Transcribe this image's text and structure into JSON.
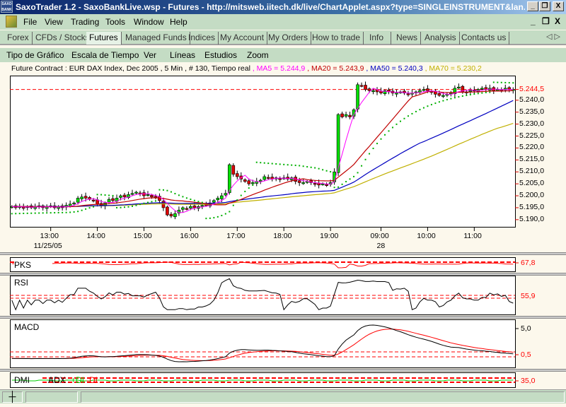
{
  "window": {
    "title": "SaxoTrader 1.2 - SaxoBankLive.wsp - Futures - http://mitsweb.iitech.dk/live/ChartApplet.aspx?type=SINGLEINSTRUMENT&lan...",
    "logo_text": "SAXO BANK",
    "minimize": "_",
    "restore": "❐",
    "close": "X"
  },
  "menu": {
    "items": [
      "File",
      "View",
      "Trading",
      "Tools",
      "Window",
      "Help"
    ],
    "doc_minimize": "_",
    "doc_restore": "❐",
    "doc_close": "X"
  },
  "tabs": {
    "items": [
      "Forex",
      "CFDs / Stocks",
      "Futures",
      "Managed Funds",
      "Indices",
      "My Account",
      "My Orders",
      "How to trade",
      "Info",
      "News",
      "Analysis",
      "Contacts us"
    ],
    "selected": "Futures",
    "prev": "◁",
    "next": "▷"
  },
  "chart_menu": {
    "items": [
      "Tipo de Gráfico",
      "Escala de Tiempo",
      "Ver",
      "Líneas",
      "Estudios",
      "Zoom"
    ]
  },
  "legend": {
    "contract": "Future Contract : EUR DAX Index, Dec 2005 , 5 Min , # 130, Tiempo real",
    "ma5": ", MA5 = 5.244,9",
    "ma20": ", MA20 = 5.243,9",
    "ma50": ", MA50 = 5.240,3",
    "ma70": ", MA70 = 5.230,2"
  },
  "colors": {
    "ma5": "#ff00ff",
    "ma20": "#c00000",
    "ma50": "#0000c0",
    "ma70": "#c0b000",
    "sar": "#00b000",
    "up": "#00e000",
    "down": "#e00000",
    "last": "#ff0000"
  },
  "chart_data": {
    "type": "candlestick",
    "title": "EUR DAX Index, Dec 2005, 5 Min",
    "ylim": [
      5187,
      5250
    ],
    "yticks": [
      "5.240,0",
      "5.235,0",
      "5.230,0",
      "5.225,0",
      "5.220,0",
      "5.215,0",
      "5.210,0",
      "5.205,0",
      "5.200,0",
      "5.195,0",
      "5.190,0"
    ],
    "ytick_values": [
      5240,
      5235,
      5230,
      5225,
      5220,
      5215,
      5210,
      5205,
      5200,
      5195,
      5190
    ],
    "last_price_label": "5.244,5",
    "last_price": 5244.5,
    "xticks": [
      "13:00",
      "14:00",
      "15:00",
      "16:00",
      "17:00",
      "18:00",
      "19:00",
      "09:00",
      "10:00",
      "11:00"
    ],
    "xtick_bars": [
      10.5,
      22.5,
      34.5,
      46.5,
      58.5,
      70.5,
      82.5,
      95.5,
      107.5,
      119.5
    ],
    "date_labels": [
      {
        "text": "11/25/05",
        "bar": 10.5
      },
      {
        "text": "28",
        "bar": 95.5
      }
    ],
    "close": [
      5195.5,
      5195,
      5195.5,
      5195,
      5195.5,
      5195,
      5195.5,
      5195.5,
      5195,
      5195.5,
      5195.5,
      5195,
      5195.5,
      5195,
      5196,
      5196.5,
      5197,
      5199,
      5199.5,
      5199,
      5198.5,
      5198,
      5196.5,
      5196,
      5197,
      5198.5,
      5198,
      5199,
      5200,
      5199.5,
      5200.5,
      5201,
      5201.5,
      5201,
      5200,
      5200.5,
      5199.5,
      5199.5,
      5198,
      5195,
      5192,
      5191.5,
      5192.5,
      5194,
      5195,
      5194.5,
      5195.5,
      5195,
      5195.5,
      5196,
      5196,
      5197,
      5198,
      5199,
      5200,
      5201,
      5213,
      5209,
      5208,
      5207,
      5206,
      5205,
      5205.5,
      5206,
      5206.5,
      5208,
      5207.5,
      5207,
      5207.5,
      5207,
      5207.5,
      5207,
      5207.5,
      5206,
      5205.5,
      5205.5,
      5206,
      5205.5,
      5205,
      5204.5,
      5205,
      5204.5,
      5205.5,
      5210,
      5234,
      5233,
      5234,
      5233,
      5236,
      5246.5,
      5246,
      5244.5,
      5244,
      5244,
      5243.5,
      5243,
      5244,
      5243.5,
      5243,
      5243,
      5243.5,
      5243,
      5242.5,
      5243,
      5243.5,
      5244,
      5244.5,
      5244,
      5243.5,
      5242.5,
      5242,
      5242,
      5242.5,
      5243,
      5245,
      5245.5,
      5243.5,
      5243.5,
      5244,
      5244,
      5244.5,
      5245,
      5244.5,
      5245,
      5244,
      5244.5,
      5244,
      5245,
      5244.5,
      5244.5
    ],
    "moving_averages": [
      5,
      20,
      50,
      70
    ]
  },
  "indicators": {
    "pks": {
      "label": "PKS",
      "value": "67,8"
    },
    "rsi": {
      "label": "RSI",
      "value": "55,9"
    },
    "macd": {
      "label": "MACD",
      "value_top": "5,0",
      "value_bottom": "0,5"
    },
    "dmi": {
      "label": "DMI",
      "adx": "ADX",
      "plus_di": "+DI",
      "minus_di": "-DI",
      "value": "35,0"
    }
  },
  "status": {
    "crosshair": "┼"
  }
}
